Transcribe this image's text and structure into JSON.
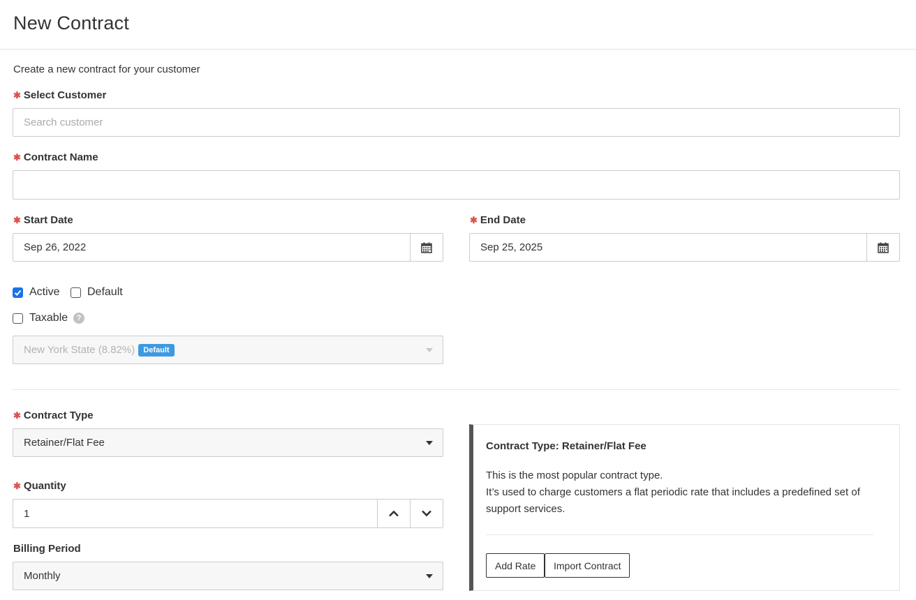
{
  "header": {
    "title": "New Contract"
  },
  "subtitle": "Create a new contract for your customer",
  "customer": {
    "label": "Select Customer",
    "placeholder": "Search customer",
    "value": ""
  },
  "contract_name": {
    "label": "Contract Name",
    "value": ""
  },
  "start_date": {
    "label": "Start Date",
    "value": "Sep 26, 2022"
  },
  "end_date": {
    "label": "End Date",
    "value": "Sep 25, 2025"
  },
  "checkboxes": {
    "active": {
      "label": "Active",
      "checked": true
    },
    "default": {
      "label": "Default",
      "checked": false
    },
    "taxable": {
      "label": "Taxable",
      "checked": false
    }
  },
  "tax_select": {
    "value": "New York State (8.82%)",
    "badge": "Default",
    "disabled": true
  },
  "contract_type": {
    "label": "Contract Type",
    "value": "Retainer/Flat Fee"
  },
  "quantity": {
    "label": "Quantity",
    "value": "1"
  },
  "billing_period": {
    "label": "Billing Period",
    "value": "Monthly"
  },
  "info_panel": {
    "title": "Contract Type: Retainer/Flat Fee",
    "line1": "This is the most popular contract type.",
    "line2": "It’s used to charge customers a flat periodic rate that includes a predefined set of support services.",
    "add_rate_label": "Add Rate",
    "import_label": "Import Contract"
  },
  "icons": {
    "required": "asterisk-icon",
    "calendar": "calendar-icon",
    "help": "question-icon",
    "up": "chevron-up-icon",
    "down": "chevron-down-icon"
  },
  "colors": {
    "required": "#d9534f",
    "checkbox_checked": "#1a73e8",
    "badge": "#3d9ae0",
    "panel_accent": "#555555"
  }
}
